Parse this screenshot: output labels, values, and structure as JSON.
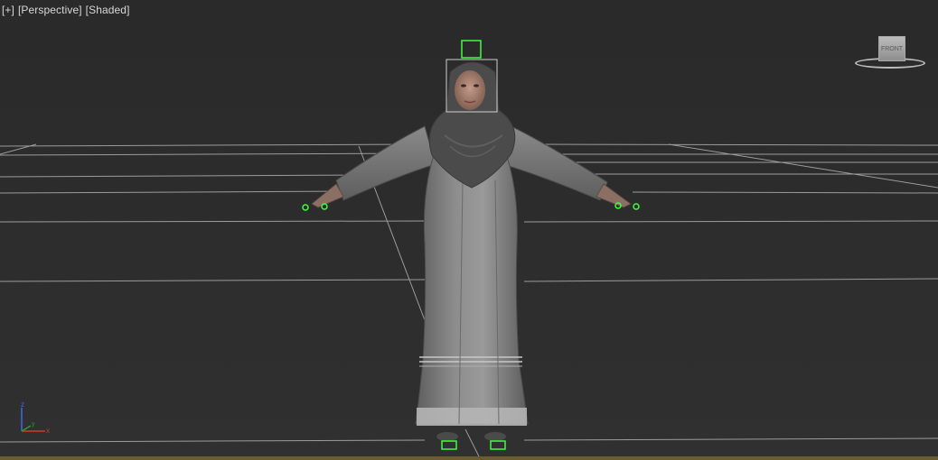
{
  "viewport": {
    "menu": [
      "[+]",
      "[Perspective]",
      "[Shaded]"
    ]
  },
  "viewcube": {
    "face_label": "FRONT"
  },
  "axis_tripod": {
    "z": "z",
    "x": "x",
    "y": "y"
  },
  "colors": {
    "background": "#2b2b2b",
    "grid": "#bdbdbd",
    "selection_helper": "#3cff3c",
    "bounding_box": "#cfcfcf",
    "axis_x": "#d43a2a",
    "axis_y": "#2a9d2a",
    "axis_z": "#3a6de0"
  },
  "icons": {
    "viewcube": "viewcube-icon",
    "axis_tripod": "axis-tripod-icon"
  }
}
